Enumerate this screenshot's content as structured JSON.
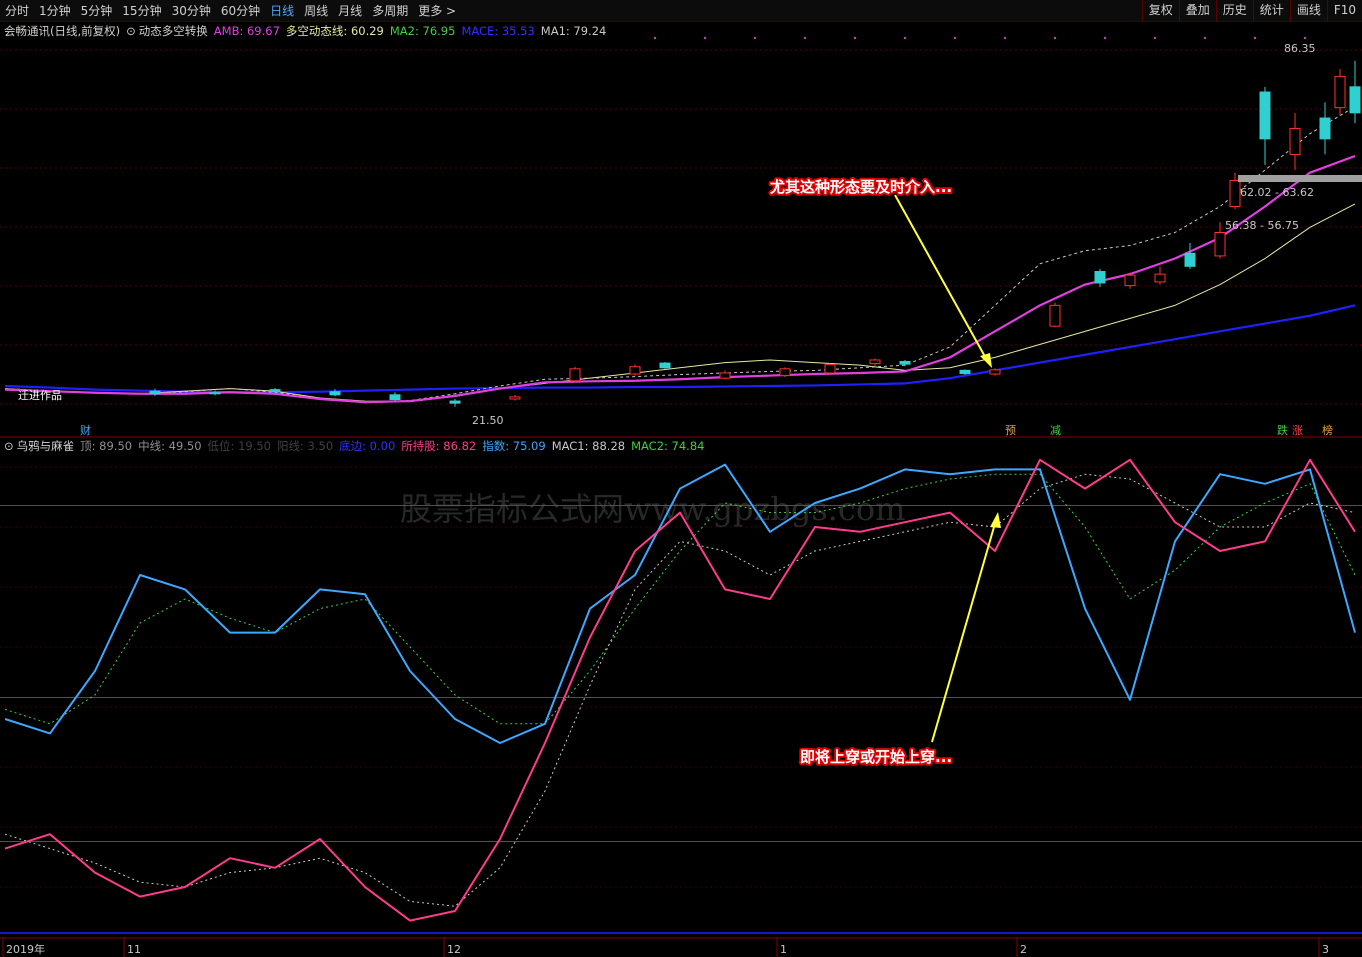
{
  "toolbar": {
    "timeframes": [
      "分时",
      "1分钟",
      "5分钟",
      "15分钟",
      "30分钟",
      "60分钟",
      "日线",
      "周线",
      "月线",
      "多周期",
      "更多 >"
    ],
    "active": "日线",
    "right_buttons": [
      "复权",
      "叠加",
      "历史",
      "统计",
      "画线",
      "F10"
    ]
  },
  "main_legend": {
    "stock": "会畅通讯(日线,前复权)",
    "indicator": "动态多空转换",
    "items": [
      {
        "text": "AMB: 69.67",
        "color": "#e040e0"
      },
      {
        "text": "多空动态线: 60.29",
        "color": "#e8e8a0"
      },
      {
        "text": "MA2: 76.95",
        "color": "#40d040"
      },
      {
        "text": "MACE: 35.53",
        "color": "#3030ff"
      },
      {
        "text": "MA1: 79.24",
        "color": "#c8c8c8"
      }
    ]
  },
  "sub_legend": {
    "indicator": "乌鸦与麻雀",
    "items": [
      {
        "text": "顶: 89.50",
        "color": "#909090"
      },
      {
        "text": "中线: 49.50",
        "color": "#909090"
      },
      {
        "text": "低位: 19.50",
        "color": "#404040"
      },
      {
        "text": "阳线: 3.50",
        "color": "#404040"
      },
      {
        "text": "底边: 0.00",
        "color": "#3030ff"
      },
      {
        "text": "所持股: 86.82",
        "color": "#ff3c8c"
      },
      {
        "text": "指数: 75.09",
        "color": "#3ca8ff"
      },
      {
        "text": "MAC1: 88.28",
        "color": "#c8c8c8"
      },
      {
        "text": "MAC2: 74.84",
        "color": "#40d040"
      }
    ]
  },
  "price_labels": {
    "high": "86.35",
    "low": "21.50",
    "range1": "62.02 - 63.62",
    "range2": "56.38 - 56.75",
    "left_note": "迁进作品"
  },
  "signals": [
    {
      "text": "财",
      "color": "#3ca8ff"
    },
    {
      "text": "预",
      "color": "#e0a040"
    },
    {
      "text": "减",
      "color": "#40d040"
    },
    {
      "text": "跌",
      "color": "#40d040"
    },
    {
      "text": "涨",
      "color": "#ff4040"
    },
    {
      "text": "榜",
      "color": "#e0a040"
    }
  ],
  "annotations": {
    "top": "尤其这种形态要及时介入...",
    "bottom": "即将上穿或开始上穿..."
  },
  "watermark": "股票指标公式网www.gpzbgs.com",
  "x_axis": [
    "2019年",
    "11",
    "12",
    "1",
    "2",
    "3"
  ],
  "chart_data": [
    {
      "type": "line",
      "title": "动态多空转换",
      "x": [
        0,
        5,
        10,
        15,
        20,
        25,
        30,
        35,
        40,
        45,
        50,
        55,
        60,
        65,
        70,
        75,
        80,
        85,
        90,
        95,
        100,
        105,
        110,
        115,
        120,
        125,
        130,
        135,
        140,
        145,
        150
      ],
      "ylim": [
        18,
        92
      ],
      "series": [
        {
          "name": "MACE",
          "color": "#2020ff",
          "values": [
            25.5,
            25.2,
            24.8,
            24.6,
            24.4,
            24.3,
            24.3,
            24.4,
            24.6,
            24.8,
            25.0,
            25.1,
            25.2,
            25.2,
            25.3,
            25.3,
            25.4,
            25.5,
            25.6,
            25.8,
            26.0,
            27.0,
            28.5,
            30.0,
            31.5,
            33.0,
            34.5,
            36.0,
            37.5,
            39.0,
            41.0
          ]
        },
        {
          "name": "多空动态线",
          "color": "#e8e8a0",
          "values": [
            25.0,
            24.5,
            24.2,
            24.0,
            24.5,
            25.0,
            24.5,
            23.2,
            22.6,
            22.5,
            23.5,
            25.0,
            26.0,
            27.0,
            28.0,
            29.0,
            30.0,
            30.5,
            30.0,
            29.5,
            28.5,
            29.0,
            31.0,
            33.5,
            36.0,
            38.5,
            41.0,
            45.0,
            50.0,
            56.0,
            60.5
          ]
        },
        {
          "name": "AMB",
          "color": "#e040e0",
          "values": [
            24.8,
            24.5,
            24.2,
            24.0,
            24.0,
            24.3,
            24.0,
            23.0,
            22.4,
            22.6,
            23.6,
            25.0,
            26.2,
            26.4,
            26.5,
            26.8,
            27.2,
            27.5,
            27.8,
            28.0,
            28.3,
            31.0,
            36.0,
            41.0,
            45.0,
            47.0,
            50.0,
            54.0,
            60.0,
            66.5,
            69.7
          ]
        },
        {
          "name": "MA1",
          "color": "#c8c8c8",
          "values": [
            25.0,
            24.6,
            24.2,
            24.0,
            24.4,
            25.0,
            24.3,
            23.0,
            22.3,
            22.7,
            24.0,
            25.5,
            26.8,
            27.0,
            27.3,
            27.7,
            28.0,
            28.3,
            28.5,
            29.0,
            29.5,
            33.0,
            41.0,
            49.0,
            51.5,
            52.5,
            55.0,
            60.0,
            67.0,
            74.0,
            79.2
          ]
        }
      ],
      "candles": [
        {
          "x": 10,
          "o": 24.5,
          "c": 24.0,
          "h": 25.0,
          "l": 23.6
        },
        {
          "x": 14,
          "o": 24.2,
          "c": 24.0,
          "h": 24.6,
          "l": 23.7
        },
        {
          "x": 18,
          "o": 24.8,
          "c": 24.4,
          "h": 25.1,
          "l": 24.2
        },
        {
          "x": 22,
          "o": 24.4,
          "c": 23.8,
          "h": 24.9,
          "l": 23.5
        },
        {
          "x": 26,
          "o": 23.8,
          "c": 22.9,
          "h": 24.3,
          "l": 22.6
        },
        {
          "x": 30,
          "o": 22.6,
          "c": 22.2,
          "h": 23.0,
          "l": 21.5
        },
        {
          "x": 34,
          "o": 23.0,
          "c": 23.4,
          "h": 23.8,
          "l": 22.7
        },
        {
          "x": 38,
          "o": 26.5,
          "c": 28.8,
          "h": 29.2,
          "l": 26.3
        },
        {
          "x": 42,
          "o": 27.8,
          "c": 29.2,
          "h": 29.6,
          "l": 27.5
        },
        {
          "x": 44,
          "o": 29.9,
          "c": 29.0,
          "h": 30.1,
          "l": 28.8
        },
        {
          "x": 48,
          "o": 27.0,
          "c": 28.0,
          "h": 28.5,
          "l": 26.8
        },
        {
          "x": 52,
          "o": 27.5,
          "c": 28.8,
          "h": 29.1,
          "l": 27.2
        },
        {
          "x": 55,
          "o": 28.0,
          "c": 29.6,
          "h": 29.9,
          "l": 27.8
        },
        {
          "x": 58,
          "o": 29.8,
          "c": 30.5,
          "h": 30.8,
          "l": 29.4
        },
        {
          "x": 60,
          "o": 30.2,
          "c": 29.7,
          "h": 30.5,
          "l": 29.3
        },
        {
          "x": 64,
          "o": 28.5,
          "c": 27.9,
          "h": 28.7,
          "l": 27.6
        },
        {
          "x": 66,
          "o": 27.8,
          "c": 28.6,
          "h": 28.9,
          "l": 27.5
        },
        {
          "x": 70,
          "o": 37.0,
          "c": 41.0,
          "h": 41.5,
          "l": 36.8
        },
        {
          "x": 73,
          "o": 47.5,
          "c": 45.3,
          "h": 48.0,
          "l": 44.5
        },
        {
          "x": 75,
          "o": 44.8,
          "c": 46.8,
          "h": 47.3,
          "l": 44.2
        },
        {
          "x": 77,
          "o": 45.5,
          "c": 47.0,
          "h": 48.5,
          "l": 45.0
        },
        {
          "x": 79,
          "o": 51.0,
          "c": 48.5,
          "h": 53.0,
          "l": 48.0
        },
        {
          "x": 81,
          "o": 50.5,
          "c": 55.0,
          "h": 57.0,
          "l": 50.0
        },
        {
          "x": 82,
          "o": 60.0,
          "c": 65.0,
          "h": 66.5,
          "l": 59.5
        },
        {
          "x": 84,
          "o": 82.0,
          "c": 73.0,
          "h": 83.0,
          "l": 68.0
        },
        {
          "x": 86,
          "o": 70.0,
          "c": 75.0,
          "h": 78.0,
          "l": 67.0
        },
        {
          "x": 88,
          "o": 77.0,
          "c": 73.0,
          "h": 80.0,
          "l": 70.0
        },
        {
          "x": 89,
          "o": 79.0,
          "c": 85.0,
          "h": 86.4,
          "l": 77.5
        },
        {
          "x": 90,
          "o": 83.0,
          "c": 78.0,
          "h": 88.0,
          "l": 76.0
        }
      ]
    },
    {
      "type": "line",
      "title": "乌鸦与麻雀",
      "x": [
        0,
        5,
        10,
        15,
        20,
        25,
        30,
        35,
        40,
        45,
        50,
        55,
        60,
        65,
        70,
        75,
        80,
        85,
        90,
        95,
        100,
        105,
        110,
        115,
        120,
        125,
        130,
        135,
        140,
        145,
        150
      ],
      "ylim": [
        0,
        100
      ],
      "series": [
        {
          "name": "指数",
          "color": "#3ca8ff",
          "values": [
            45,
            42,
            55,
            75,
            72,
            63,
            63,
            72,
            71,
            55,
            45,
            40,
            44,
            68,
            75,
            93,
            98,
            84,
            90,
            93,
            97,
            96,
            97,
            97,
            68,
            49,
            82,
            96,
            94,
            97,
            63
          ]
        },
        {
          "name": "所持股",
          "color": "#ff3c8c",
          "values": [
            18,
            21,
            13,
            8,
            10,
            16,
            14,
            20,
            10,
            3,
            5,
            20,
            40,
            62,
            80,
            88,
            72,
            70,
            85,
            84,
            86,
            88,
            80,
            99,
            93,
            99,
            86,
            80,
            82,
            99,
            84
          ]
        },
        {
          "name": "MAC1",
          "color": "#c8c8c8",
          "values": [
            21,
            18,
            15,
            11,
            10,
            13,
            14,
            16,
            13,
            7,
            6,
            14,
            30,
            52,
            72,
            82,
            80,
            75,
            80,
            82,
            84,
            86,
            85,
            93,
            96,
            95,
            90,
            85,
            85,
            90,
            88
          ]
        },
        {
          "name": "MAC2",
          "color": "#40d040",
          "values": [
            47,
            44,
            50,
            65,
            70,
            66,
            63,
            68,
            70,
            60,
            50,
            44,
            44,
            55,
            68,
            80,
            90,
            88,
            88,
            90,
            93,
            95,
            96,
            96,
            85,
            70,
            76,
            85,
            90,
            94,
            75
          ]
        }
      ],
      "ref_lines": [
        {
          "name": "顶",
          "value": 89.5
        },
        {
          "name": "中线",
          "value": 49.5
        },
        {
          "name": "低位",
          "value": 19.5
        }
      ]
    }
  ]
}
